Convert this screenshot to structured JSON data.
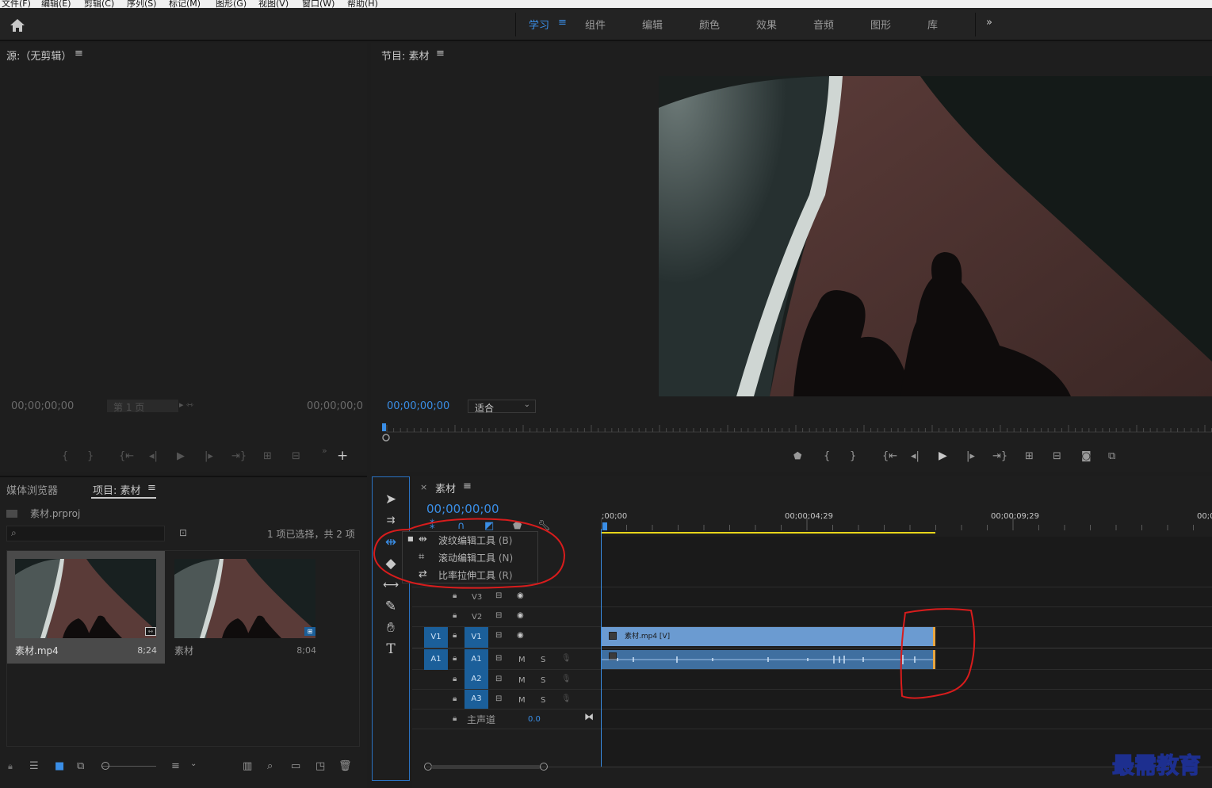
{
  "menubar": [
    "文件(F)",
    "编辑(E)",
    "剪辑(C)",
    "序列(S)",
    "标记(M)",
    "图形(G)",
    "视图(V)",
    "窗口(W)",
    "帮助(H)"
  ],
  "workspaces": {
    "tabs": [
      "学习",
      "组件",
      "编辑",
      "颜色",
      "效果",
      "音频",
      "图形",
      "库"
    ],
    "active": "学习",
    "more": "»"
  },
  "source": {
    "title": "源:（无剪辑）",
    "menu_icon": "≡",
    "tc_left": "00;00;00;00",
    "page_label": "第 1 页",
    "tc_right": "00;00;00;0"
  },
  "program": {
    "title": "节目: 素材",
    "menu_icon": "≡",
    "timecode": "00;00;00;00",
    "zoom": "适合"
  },
  "project": {
    "tab_media": "媒体浏览器",
    "tab_project": "项目: 素材",
    "menu_icon": "≡",
    "file": "素材.prproj",
    "selection": "1 项已选择，共 2 项",
    "items": [
      {
        "name": "素材.mp4",
        "duration": "8;24"
      },
      {
        "name": "素材",
        "duration": "8;04"
      }
    ]
  },
  "tools_flyout": [
    {
      "label": "波纹编辑工具",
      "key": "(B)"
    },
    {
      "label": "滚动编辑工具",
      "key": "(N)"
    },
    {
      "label": "比率拉伸工具",
      "key": "(R)"
    }
  ],
  "timeline": {
    "close": "×",
    "title": "素材",
    "menu_icon": "≡",
    "timecode": "00;00;00;00",
    "ruler": [
      ";00;00",
      "00;00;04;29",
      "00;00;09;29",
      "00;0"
    ],
    "video_tracks": [
      "V3",
      "V2",
      "V1"
    ],
    "audio_tracks": [
      "A1",
      "A2",
      "A3"
    ],
    "source_patch_v": "V1",
    "source_patch_a": "A1",
    "mute": "M",
    "solo": "S",
    "master": "主声道",
    "master_value": "0.0",
    "clip_label": "素材.mp4 [V]"
  },
  "watermark": "最需教育",
  "colors": {
    "accent": "#3a8ee6",
    "clip_video": "#6b9bd1",
    "clip_audio": "#3f6fa0",
    "annotation": "#d81c1c",
    "work_area": "#e8d51a"
  }
}
